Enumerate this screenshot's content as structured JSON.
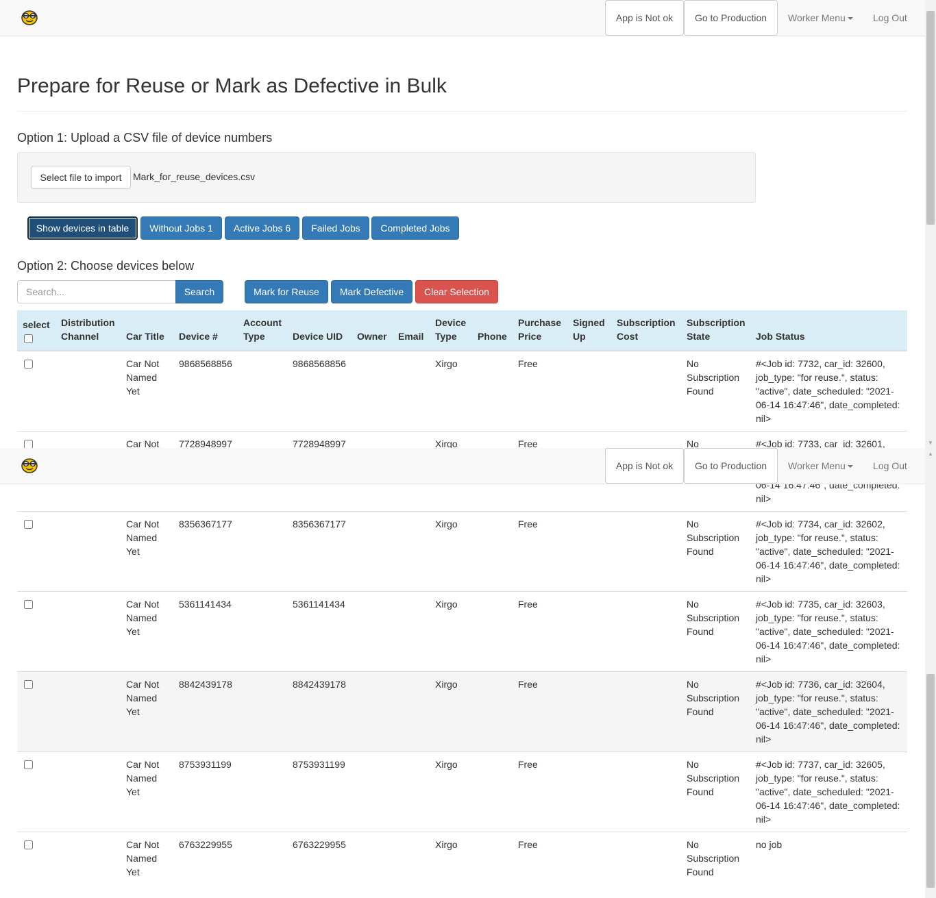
{
  "navbar": {
    "logo": "robot-logo",
    "app_status": "App is Not ok",
    "production": "Go to Production",
    "worker_menu": "Worker Menu",
    "logout": "Log Out"
  },
  "page": {
    "title": "Prepare for Reuse or Mark as Defective in Bulk"
  },
  "option1": {
    "title": "Option 1: Upload a CSV file of device numbers",
    "select_file": "Select file to import",
    "file_name": "Mark_for_reuse_devices.csv"
  },
  "filters": {
    "show_table": "Show devices in table",
    "without_jobs": "Without Jobs 1",
    "active_jobs": "Active Jobs 6",
    "failed_jobs": "Failed Jobs",
    "completed_jobs": "Completed Jobs"
  },
  "option2": {
    "title": "Option 2: Choose devices below",
    "search_placeholder": "Search...",
    "search_button": "Search",
    "mark_reuse": "Mark for Reuse",
    "mark_defective": "Mark Defective",
    "clear_selection": "Clear Selection"
  },
  "table": {
    "headers": {
      "select": "select",
      "distribution_channel": "Distribution Channel",
      "car_title": "Car Title",
      "device_num": "Device #",
      "account_type": "Account Type",
      "device_uid": "Device UID",
      "owner": "Owner",
      "email": "Email",
      "device_type": "Device Type",
      "phone": "Phone",
      "purchase_price": "Purchase Price",
      "signed_up": "Signed Up",
      "subscription_cost": "Subscription Cost",
      "subscription_state": "Subscription State",
      "job_status": "Job Status"
    },
    "rows": [
      {
        "car_title": "Car Not Named Yet",
        "device_num": "9868568856",
        "device_uid": "9868568856",
        "device_type": "Xirgo",
        "purchase_price": "Free",
        "subscription_state": "No Subscription Found",
        "job_status": "#<Job id: 7732, car_id: 32600, job_type: \"for reuse.\", status: \"active\", date_scheduled: \"2021-06-14 16:47:46\", date_completed: nil>"
      },
      {
        "car_title": "Car Not Named Yet",
        "device_num": "7728948997",
        "device_uid": "7728948997",
        "device_type": "Xirgo",
        "purchase_price": "Free",
        "subscription_state": "No Subscription Found",
        "job_status": "#<Job id: 7733, car_id: 32601, job_type: \"for reuse.\", status: \"active\", date_scheduled: \"2021-06-14 16:47:46\", date_completed: nil>"
      },
      {
        "car_title": "Car Not Named Yet",
        "device_num": "8356367177",
        "device_uid": "8356367177",
        "device_type": "Xirgo",
        "purchase_price": "Free",
        "subscription_state": "No Subscription Found",
        "job_status": "#<Job id: 7734, car_id: 32602, job_type: \"for reuse.\", status: \"active\", date_scheduled: \"2021-06-14 16:47:46\", date_completed: nil>"
      },
      {
        "car_title": "Car Not Named Yet",
        "device_num": "5361141434",
        "device_uid": "5361141434",
        "device_type": "Xirgo",
        "purchase_price": "Free",
        "subscription_state": "No Subscription Found",
        "job_status": "#<Job id: 7735, car_id: 32603, job_type: \"for reuse.\", status: \"active\", date_scheduled: \"2021-06-14 16:47:46\", date_completed: nil>"
      },
      {
        "car_title": "Car Not Named Yet",
        "device_num": "8842439178",
        "device_uid": "8842439178",
        "device_type": "Xirgo",
        "purchase_price": "Free",
        "subscription_state": "No Subscription Found",
        "job_status": "#<Job id: 7736, car_id: 32604, job_type: \"for reuse.\", status: \"active\", date_scheduled: \"2021-06-14 16:47:46\", date_completed: nil>"
      },
      {
        "car_title": "Car Not Named Yet",
        "device_num": "8753931199",
        "device_uid": "8753931199",
        "device_type": "Xirgo",
        "purchase_price": "Free",
        "subscription_state": "No Subscription Found",
        "job_status": "#<Job id: 7737, car_id: 32605, job_type: \"for reuse.\", status: \"active\", date_scheduled: \"2021-06-14 16:47:46\", date_completed: nil>"
      },
      {
        "car_title": "Car Not Named Yet",
        "device_num": "6763229955",
        "device_uid": "6763229955",
        "device_type": "Xirgo",
        "purchase_price": "Free",
        "subscription_state": "No Subscription Found",
        "job_status": "no job"
      }
    ]
  },
  "colors": {
    "primary": "#337ab7",
    "danger": "#d9534f",
    "table_header": "#d9edf7",
    "navbar": "#f8f8f8"
  }
}
